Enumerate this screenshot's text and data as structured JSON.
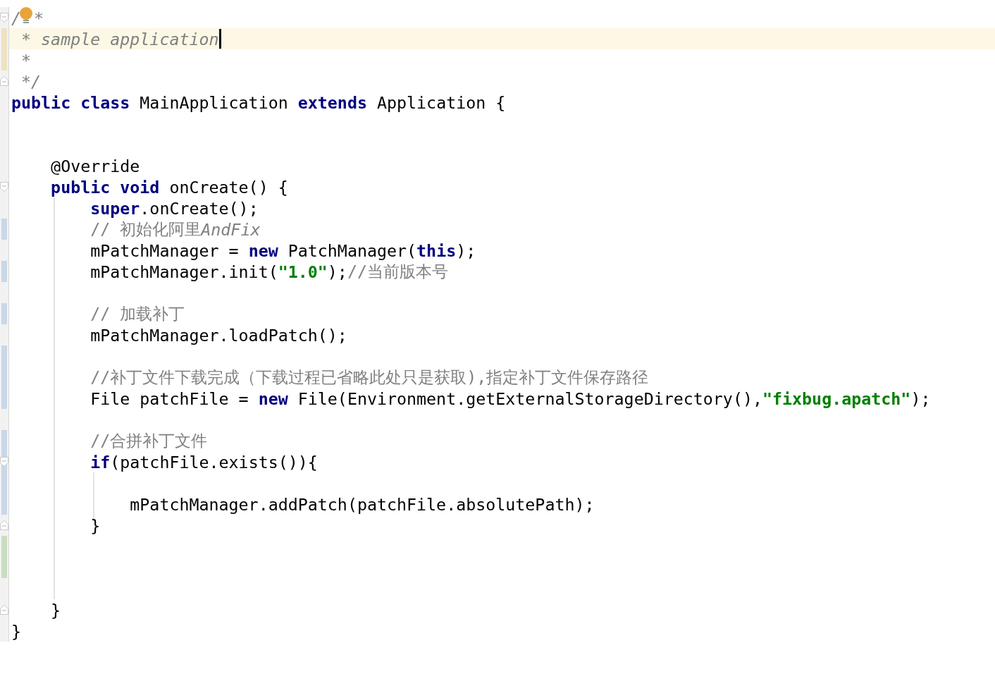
{
  "editor": {
    "lines": [
      {
        "fold_start": true,
        "fold_end": false,
        "current": false,
        "tokens": [
          {
            "kind": "doc",
            "text": "/"
          },
          {
            "kind": "doc",
            "text": "*"
          }
        ]
      },
      {
        "fold_start": false,
        "fold_end": false,
        "current": true,
        "color": "#efe2c4",
        "tokens": [
          {
            "kind": "doc",
            "text": " * sample application"
          }
        ]
      },
      {
        "fold_start": false,
        "fold_end": false,
        "current": false,
        "color": "#efe2c4",
        "tokens": [
          {
            "kind": "doc",
            "text": " *"
          }
        ]
      },
      {
        "fold_start": false,
        "fold_end": true,
        "current": false,
        "tokens": [
          {
            "kind": "doc",
            "text": " */"
          }
        ]
      },
      {
        "fold_start": false,
        "fold_end": false,
        "current": false,
        "tokens": [
          {
            "kind": "keyword",
            "text": "public class"
          },
          {
            "kind": "plain",
            "text": " MainApplication "
          },
          {
            "kind": "keyword",
            "text": "extends"
          },
          {
            "kind": "plain",
            "text": " Application {"
          }
        ]
      },
      {
        "fold_start": false,
        "fold_end": false,
        "current": false
      },
      {
        "fold_start": false,
        "fold_end": false,
        "current": false
      },
      {
        "fold_start": false,
        "fold_end": false,
        "current": false,
        "tokens": [
          {
            "kind": "plain",
            "text": "    @Override"
          }
        ]
      },
      {
        "fold_start": true,
        "fold_end": false,
        "current": false,
        "tokens": [
          {
            "kind": "keyword",
            "text": "    public void"
          },
          {
            "kind": "plain",
            "text": " onCreate() {"
          }
        ]
      },
      {
        "fold_start": false,
        "fold_end": false,
        "current": false,
        "tokens": [
          {
            "kind": "keyword",
            "text": "        super"
          },
          {
            "kind": "plain",
            "text": ".onCreate();"
          }
        ]
      },
      {
        "fold_start": false,
        "fold_end": false,
        "current": false,
        "color": "#c9d7e8",
        "tokens": [
          {
            "kind": "comment",
            "text": "        // 初始化阿里"
          },
          {
            "kind": "italic_comment",
            "text": "AndFix"
          }
        ]
      },
      {
        "fold_start": false,
        "fold_end": false,
        "current": false,
        "tokens": [
          {
            "kind": "plain",
            "text": "        mPatchManager = "
          },
          {
            "kind": "keyword",
            "text": "new"
          },
          {
            "kind": "plain",
            "text": " PatchManager("
          },
          {
            "kind": "keyword",
            "text": "this"
          },
          {
            "kind": "plain",
            "text": ");"
          }
        ]
      },
      {
        "fold_start": false,
        "fold_end": false,
        "current": false,
        "color": "#c9d7e8",
        "tokens": [
          {
            "kind": "plain",
            "text": "        mPatchManager.init("
          },
          {
            "kind": "string",
            "text": "\"1.0\""
          },
          {
            "kind": "plain",
            "text": ");"
          },
          {
            "kind": "comment",
            "text": "//当前版本号"
          }
        ]
      },
      {
        "fold_start": false,
        "fold_end": false,
        "current": false
      },
      {
        "fold_start": false,
        "fold_end": false,
        "current": false,
        "color": "#c9d7e8",
        "tokens": [
          {
            "kind": "comment",
            "text": "        // 加载补丁"
          }
        ]
      },
      {
        "fold_start": false,
        "fold_end": false,
        "current": false,
        "tokens": [
          {
            "kind": "plain",
            "text": "        mPatchManager.loadPatch();"
          }
        ]
      },
      {
        "fold_start": false,
        "fold_end": false,
        "current": false,
        "color": "#c9d7e8"
      },
      {
        "fold_start": false,
        "fold_end": false,
        "current": false,
        "color": "#c9d7e8",
        "tokens": [
          {
            "kind": "comment",
            "text": "        //补丁文件下载完成（下载过程已省略此处只是获取),指定补丁文件保存路径"
          }
        ]
      },
      {
        "fold_start": false,
        "fold_end": false,
        "current": false,
        "color": "#c9d7e8",
        "tokens": [
          {
            "kind": "plain",
            "text": "        File patchFile = "
          },
          {
            "kind": "keyword",
            "text": "new"
          },
          {
            "kind": "plain",
            "text": " File(Environment.getExternalStorageDirectory(),"
          },
          {
            "kind": "string",
            "text": "\"fixbug.apatch\""
          },
          {
            "kind": "plain",
            "text": ");"
          }
        ]
      },
      {
        "fold_start": false,
        "fold_end": false,
        "current": false
      },
      {
        "fold_start": false,
        "fold_end": false,
        "current": false,
        "color": "#c9d7e8",
        "tokens": [
          {
            "kind": "comment",
            "text": "        //合拼补丁文件"
          }
        ]
      },
      {
        "fold_start": true,
        "fold_end": false,
        "current": false,
        "color": "#c9d7e8",
        "tokens": [
          {
            "kind": "keyword",
            "text": "        if"
          },
          {
            "kind": "plain",
            "text": "(patchFile.exists()){"
          }
        ]
      },
      {
        "fold_start": false,
        "fold_end": false,
        "current": false,
        "color": "#c9d7e8"
      },
      {
        "fold_start": false,
        "fold_end": false,
        "current": false,
        "color": "#c9d7e8",
        "tokens": [
          {
            "kind": "plain",
            "text": "            mPatchManager.addPatch(patchFile.absolutePath);"
          }
        ]
      },
      {
        "fold_start": false,
        "fold_end": true,
        "current": false,
        "tokens": [
          {
            "kind": "plain",
            "text": "        }"
          }
        ]
      },
      {
        "fold_start": false,
        "fold_end": false,
        "current": false,
        "color": "#c9dec1"
      },
      {
        "fold_start": false,
        "fold_end": false,
        "current": false,
        "color": "#c9dec1"
      },
      {
        "fold_start": false,
        "fold_end": false,
        "current": false
      },
      {
        "fold_start": false,
        "fold_end": true,
        "current": false,
        "tokens": [
          {
            "kind": "plain",
            "text": "    }"
          }
        ]
      },
      {
        "fold_start": false,
        "fold_end": false,
        "current": false,
        "tokens": [
          {
            "kind": "plain",
            "text": "}"
          }
        ]
      }
    ]
  }
}
